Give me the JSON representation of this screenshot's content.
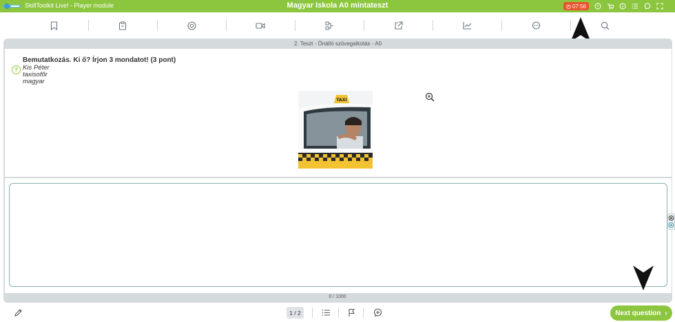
{
  "topbar": {
    "app_name": "SkillToolkit Live! - Player module",
    "title": "Magyar Iskola A0 mintateszt",
    "timer": "07:56",
    "icons": [
      "question-icon",
      "cart-icon",
      "info-icon",
      "list-icon",
      "chat-icon",
      "fullscreen-icon"
    ]
  },
  "toolbar": {
    "tools": [
      "bookmark-icon",
      "clipboard-icon",
      "record-icon",
      "video-icon",
      "flow-icon",
      "external-link-icon",
      "chart-icon",
      "comment-icon",
      "search-icon"
    ]
  },
  "section": {
    "title": "2. Teszt - Önálló szövegalkotás - A0"
  },
  "question": {
    "title": "Bemutatkozás. Ki ő? Írjon 3 mondatot! (3 pont)",
    "lines": [
      "Kis Péter",
      "taxisofőr",
      "magyar"
    ],
    "image_label": "TAXI"
  },
  "answer": {
    "value": "",
    "counter": "0 / 1000"
  },
  "bottom": {
    "pager": "1 / 2",
    "next_label": "Next question",
    "next_icon": "›"
  },
  "colors": {
    "accent": "#8cc63f",
    "timer": "#e8542b"
  }
}
